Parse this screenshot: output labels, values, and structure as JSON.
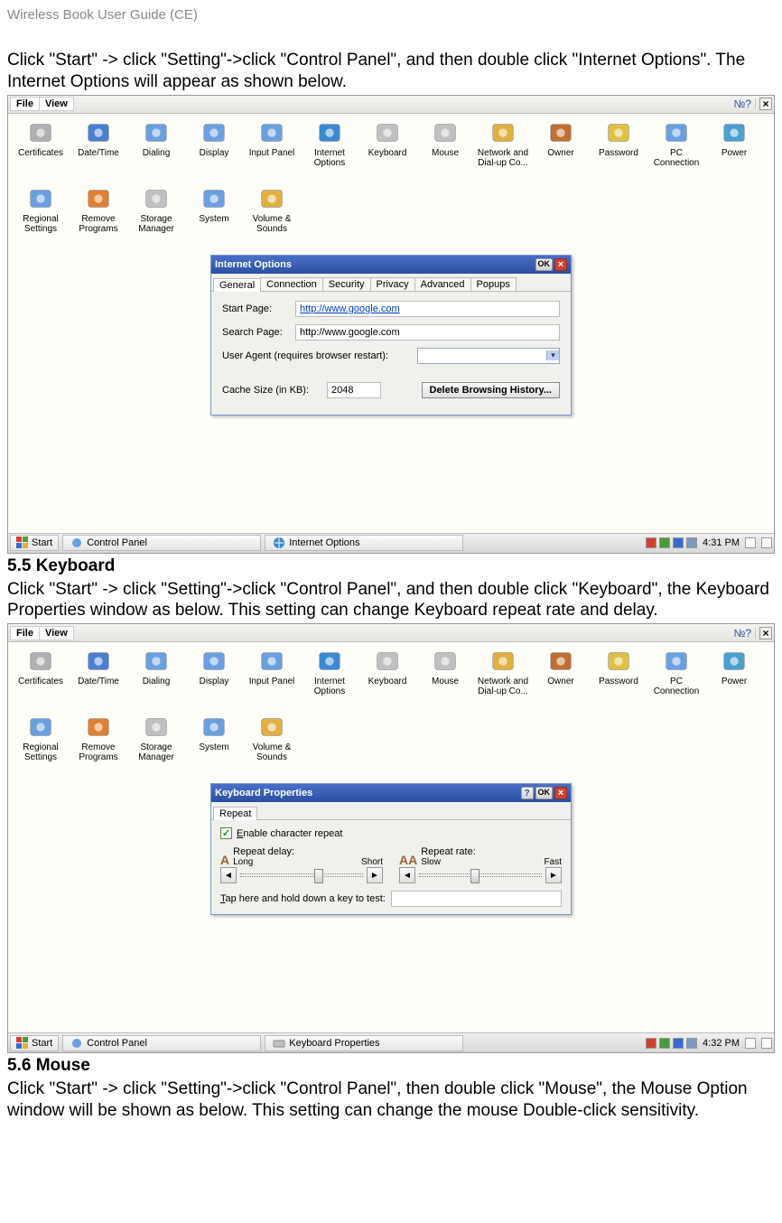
{
  "doc_title": "Wireless Book User Guide (CE)",
  "para1": "Click \"Start\" -> click \"Setting\"->click \"Control Panel\", and then double click \"Internet Options\". The Internet Options will appear as shown below.",
  "para2": "Click \"Start\" -> click \"Setting\"->click \"Control Panel\", and then double click \"Keyboard\", the Keyboard Properties window as below. This setting can change Keyboard repeat rate and delay.",
  "para3": "Click \"Start\" -> click \"Setting\"->click \"Control Panel\", then double click \"Mouse\", the Mouse Option window will be shown as below. This setting can change the mouse Double-click sensitivity.",
  "heading_55": "5.5   Keyboard",
  "heading_56": "5.6   Mouse",
  "menubar": {
    "file": "File",
    "view": "View"
  },
  "cp_items": [
    "Certificates",
    "Date/Time",
    "Dialing",
    "Display",
    "Input Panel",
    "Internet Options",
    "Keyboard",
    "Mouse",
    "Network and Dial-up Co...",
    "Owner",
    "Password",
    "PC Connection",
    "Power",
    "Regional Settings",
    "Remove Programs",
    "Storage Manager",
    "System",
    "Volume & Sounds"
  ],
  "internet_options": {
    "title": "Internet Options",
    "tabs": [
      "General",
      "Connection",
      "Security",
      "Privacy",
      "Advanced",
      "Popups"
    ],
    "start_page_label": "Start Page:",
    "start_page_value": "http://www.google.com",
    "search_page_label": "Search Page:",
    "search_page_value": "http://www.google.com",
    "ua_label": "User Agent (requires browser restart):",
    "cache_label": "Cache Size (in KB):",
    "cache_value": "2048",
    "delete_btn": "Delete Browsing History...",
    "ok": "OK"
  },
  "keyboard_props": {
    "title": "Keyboard Properties",
    "tab": "Repeat",
    "enable_label": "Enable character repeat",
    "repeat_delay": "Repeat delay:",
    "long": "Long",
    "short": "Short",
    "repeat_rate": "Repeat rate:",
    "slow": "Slow",
    "fast": "Fast",
    "test_label": "Tap here and hold down a key to test:",
    "ok": "OK"
  },
  "taskbar": {
    "start": "Start",
    "control_panel": "Control Panel",
    "internet_options": "Internet Options",
    "keyboard_properties": "Keyboard Properties",
    "time1": "4:31 PM",
    "time2": "4:32 PM"
  },
  "icon_colors": {
    "Certificates": "#b0b0b0",
    "Date/Time": "#4a7fd0",
    "Dialing": "#6aa0e0",
    "Display": "#6aa0e0",
    "Input Panel": "#6aa0e0",
    "Internet Options": "#3a8ad0",
    "Keyboard": "#c0c0c0",
    "Mouse": "#c0c0c0",
    "Network and Dial-up Co...": "#e0b040",
    "Owner": "#c07030",
    "Password": "#e0c040",
    "PC Connection": "#6aa0e0",
    "Power": "#4aa0d0",
    "Regional Settings": "#6aa0e0",
    "Remove Programs": "#e08030",
    "Storage Manager": "#c0c0c0",
    "System": "#6aa0e0",
    "Volume & Sounds": "#e0b040"
  }
}
